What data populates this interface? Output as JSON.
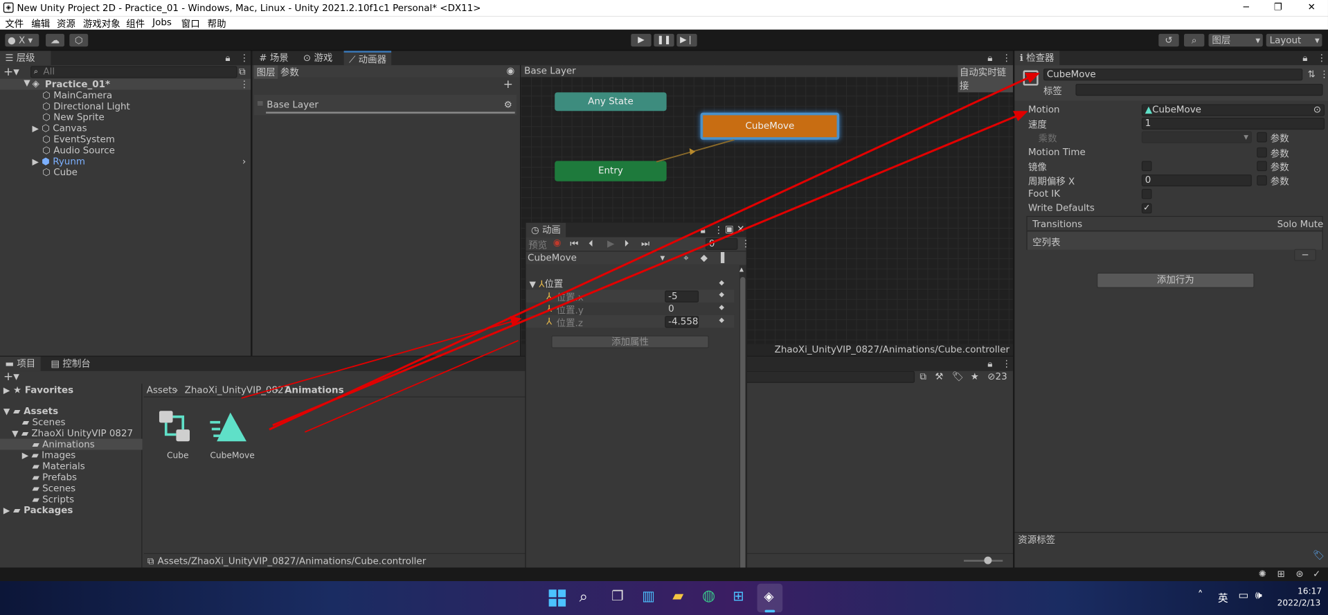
{
  "window": {
    "title": "New Unity Project 2D - Practice_01 - Windows, Mac, Linux - Unity 2021.2.10f1c1 Personal* <DX11>",
    "min": "─",
    "max": "❐",
    "close": "✕"
  },
  "menu": [
    "文件",
    "编辑",
    "资源",
    "游戏对象",
    "组件",
    "Jobs",
    "窗口",
    "帮助"
  ],
  "toolbar": {
    "account": "X",
    "layers": "图层",
    "layout": "Layout"
  },
  "hierarchy": {
    "tab": "层级",
    "search_placeholder": "All",
    "scene": "Practice_01*",
    "items": [
      "MainCamera",
      "Directional Light",
      "New Sprite",
      "Canvas",
      "EventSystem",
      "Audio Source",
      "Ryunm",
      "Cube"
    ]
  },
  "center_tabs": {
    "scene": "场景",
    "game": "游戏",
    "animator": "动画器"
  },
  "animator": {
    "sub_tabs": [
      "图层",
      "参数"
    ],
    "layer_name": "Base Layer",
    "breadcrumb": "Base Layer",
    "live_link": "自动实时链接",
    "states": {
      "any": "Any State",
      "move": "CubeMove",
      "entry": "Entry"
    },
    "path": "ZhaoXi_UnityVIP_0827/Animations/Cube.controller"
  },
  "animation": {
    "tab": "动画",
    "preview": "预览",
    "frame": "0",
    "clip": "CubeMove",
    "group": "位置",
    "props": [
      {
        "name": "位置.x",
        "value": "-5"
      },
      {
        "name": "位置.y",
        "value": "0"
      },
      {
        "name": "位置.z",
        "value": "-4.558"
      }
    ],
    "add_property": "添加属性"
  },
  "inspector": {
    "tab": "检查器",
    "name": "CubeMove",
    "tag_label": "标签",
    "fields": {
      "motion": "Motion",
      "motion_value": "CubeMove",
      "speed": "速度",
      "speed_value": "1",
      "multiplier": "乘数",
      "param": "参数",
      "motion_time": "Motion Time",
      "mirror": "镜像",
      "cycle_offset": "周期偏移 X",
      "cycle_value": "0",
      "foot_ik": "Foot IK",
      "write_defaults": "Write Defaults"
    },
    "transitions": {
      "header": "Transitions",
      "solo": "Solo",
      "mute": "Mute",
      "empty": "空列表"
    },
    "add_behaviour": "添加行为",
    "asset_labels": "资源标签"
  },
  "project": {
    "tabs": [
      "项目",
      "控制台"
    ],
    "favorites": "Favorites",
    "tree": [
      {
        "label": "Assets",
        "bold": true
      },
      {
        "label": "Scenes"
      },
      {
        "label": "ZhaoXi UnityVIP 0827"
      },
      {
        "label": "Animations"
      },
      {
        "label": "Images"
      },
      {
        "label": "Materials"
      },
      {
        "label": "Prefabs"
      },
      {
        "label": "Scenes"
      },
      {
        "label": "Scripts"
      },
      {
        "label": "Packages",
        "bold": true
      }
    ],
    "breadcrumb": [
      "Assets",
      "ZhaoXi_UnityVIP_0827",
      "Animations"
    ],
    "assets": [
      {
        "name": "Cube"
      },
      {
        "name": "CubeMove"
      }
    ],
    "hidden_count": "23",
    "status_path": "Assets/ZhaoXi_UnityVIP_0827/Animations/Cube.controller"
  },
  "taskbar": {
    "lang": "英",
    "time": "16:17",
    "date": "2022/2/13"
  },
  "colors": {
    "accent": "#2c5d87",
    "any_state": "#3d8c7e",
    "move_state": "#c86d12",
    "entry_state": "#1e7a3c",
    "arrow": "#e10000",
    "teal": "#5fe0c8"
  }
}
